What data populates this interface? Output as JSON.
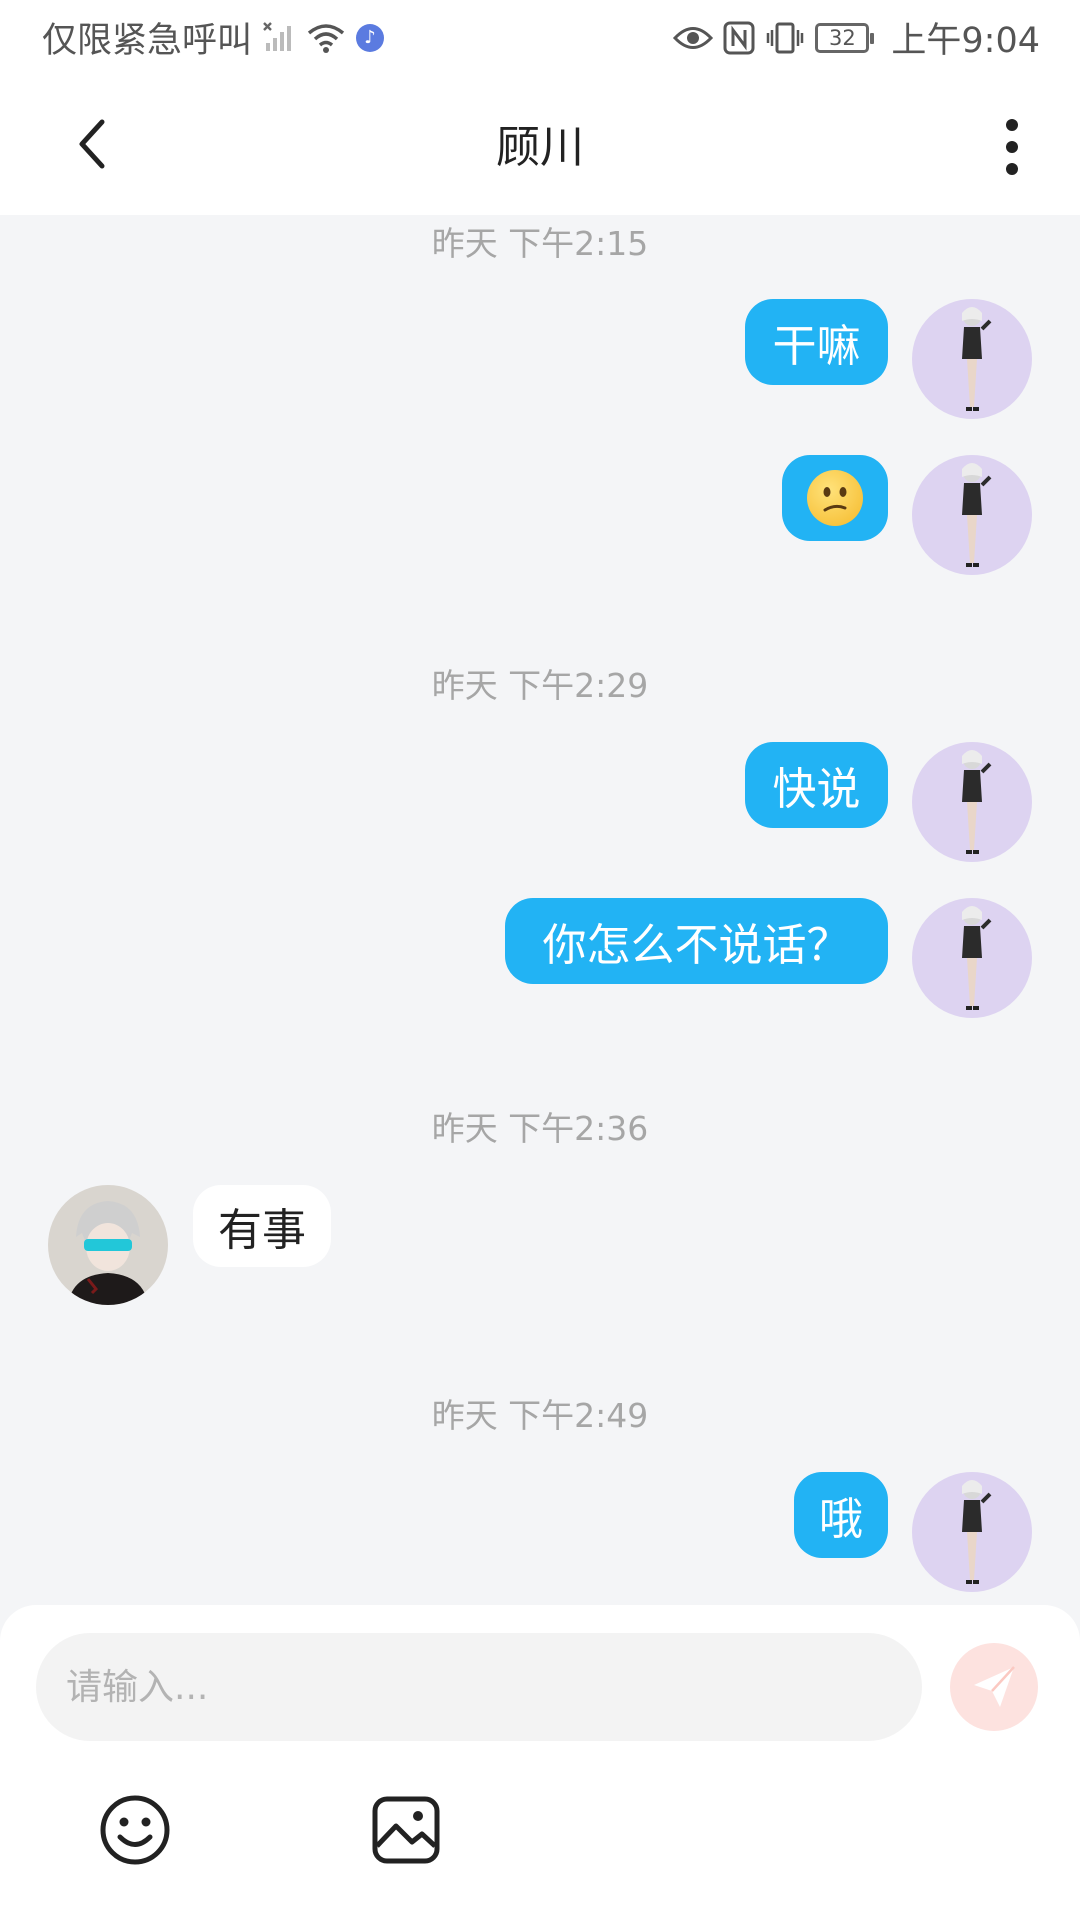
{
  "status_bar": {
    "carrier_text": "仅限紧急呼叫",
    "battery_level": "32",
    "time": "上午9:04",
    "icons": [
      "signal-off-icon",
      "wifi-icon",
      "music-app-icon",
      "eye-icon",
      "nfc-icon",
      "vibrate-icon",
      "battery-icon"
    ]
  },
  "header": {
    "title": "顾川",
    "back_icon": "chevron-left-icon",
    "more_icon": "more-vertical-icon"
  },
  "messages": [
    {
      "type": "timestamp",
      "text": "昨天 下午2:15"
    },
    {
      "type": "message",
      "side": "me",
      "text": "干嘛"
    },
    {
      "type": "message",
      "side": "me",
      "emoji": "confused-face-emoji"
    },
    {
      "type": "timestamp",
      "text": "昨天 下午2:29"
    },
    {
      "type": "message",
      "side": "me",
      "text": "快说"
    },
    {
      "type": "message",
      "side": "me",
      "text": "你怎么不说话？"
    },
    {
      "type": "timestamp",
      "text": "昨天 下午2:36"
    },
    {
      "type": "message",
      "side": "other",
      "text": "有事"
    },
    {
      "type": "timestamp",
      "text": "昨天 下午2:49"
    },
    {
      "type": "message",
      "side": "me",
      "text": "哦"
    }
  ],
  "composer": {
    "placeholder": "请输入...",
    "value": "",
    "send_icon": "send-icon",
    "tools": [
      "emoji-icon",
      "image-icon"
    ]
  },
  "colors": {
    "my_bubble": "#22b3f4",
    "other_bubble": "#ffffff",
    "chat_background": "#f4f5f7",
    "send_button": "#fde2df",
    "timestamp_text": "#a6a6a6"
  }
}
